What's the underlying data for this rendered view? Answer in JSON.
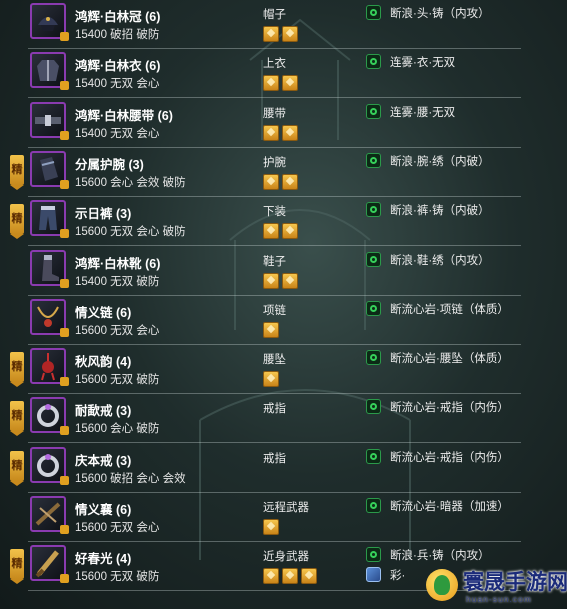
{
  "colors": {
    "name": "#ffffff",
    "divider": "#cdd6d6",
    "refine_badge": "#e8a830",
    "thumb_border": "#8a3bb0",
    "effect_green": "#36d05a"
  },
  "items": [
    {
      "name": "鸿辉·白林冠 (6)",
      "attrs": "15400 破招 破防",
      "slot": "帽子",
      "gems": 2,
      "refined": false,
      "icon": "hat-icon",
      "effects": [
        {
          "icon": "green",
          "text": "断浪·头·铸（内攻）"
        }
      ]
    },
    {
      "name": "鸿辉·白林衣 (6)",
      "attrs": "15400 无双 会心",
      "slot": "上衣",
      "gems": 2,
      "refined": false,
      "icon": "robe-icon",
      "effects": [
        {
          "icon": "green",
          "text": "连雾·衣·无双"
        }
      ]
    },
    {
      "name": "鸿辉·白林腰带 (6)",
      "attrs": "15400 无双 会心",
      "slot": "腰带",
      "gems": 2,
      "refined": false,
      "icon": "belt-icon",
      "effects": [
        {
          "icon": "green",
          "text": "连雾·腰·无双"
        }
      ]
    },
    {
      "name": "分属护腕 (3)",
      "attrs": "15600 会心 会效 破防",
      "slot": "护腕",
      "gems": 2,
      "refined": true,
      "icon": "bracer-icon",
      "effects": [
        {
          "icon": "green",
          "text": "断浪·腕·绣（内破）"
        }
      ]
    },
    {
      "name": "示日裤 (3)",
      "attrs": "15600 无双 会心 破防",
      "slot": "下装",
      "gems": 2,
      "refined": true,
      "icon": "pants-icon",
      "effects": [
        {
          "icon": "green",
          "text": "断浪·裤·铸（内破）"
        }
      ]
    },
    {
      "name": "鸿辉·白林靴 (6)",
      "attrs": "15400 无双 破防",
      "slot": "鞋子",
      "gems": 2,
      "refined": false,
      "icon": "boots-icon",
      "effects": [
        {
          "icon": "green",
          "text": "断浪·鞋·绣（内攻）"
        }
      ]
    },
    {
      "name": "情义链 (6)",
      "attrs": "15600 无双 会心",
      "slot": "项链",
      "gems": 1,
      "refined": false,
      "icon": "necklace-icon",
      "effects": [
        {
          "icon": "green",
          "text": "断流心岩·项链（体质）"
        }
      ]
    },
    {
      "name": "秋风韵 (4)",
      "attrs": "15600 无双 破防",
      "slot": "腰坠",
      "gems": 1,
      "refined": true,
      "icon": "pendant-icon",
      "effects": [
        {
          "icon": "green",
          "text": "断流心岩·腰坠（体质）"
        }
      ]
    },
    {
      "name": "耐歃戒 (3)",
      "attrs": "15600 会心 破防",
      "slot": "戒指",
      "gems": 0,
      "refined": true,
      "icon": "ring-icon",
      "effects": [
        {
          "icon": "green",
          "text": "断流心岩·戒指（内伤）"
        }
      ]
    },
    {
      "name": "庆本戒 (3)",
      "attrs": "15600 破招 会心 会效",
      "slot": "戒指",
      "gems": 0,
      "refined": true,
      "icon": "ring-icon",
      "effects": [
        {
          "icon": "green",
          "text": "断流心岩·戒指（内伤）"
        }
      ]
    },
    {
      "name": "情义襄 (6)",
      "attrs": "15600 无双 会心",
      "slot": "远程武器",
      "gems": 1,
      "refined": false,
      "icon": "ranged-weapon-icon",
      "effects": [
        {
          "icon": "green",
          "text": "断流心岩·暗器（加速）"
        }
      ]
    },
    {
      "name": "好春光 (4)",
      "attrs": "15600 无双 破防",
      "slot": "近身武器",
      "gems": 3,
      "refined": true,
      "icon": "melee-weapon-icon",
      "effects": [
        {
          "icon": "green",
          "text": "断浪·兵·铸（内攻）"
        },
        {
          "icon": "blue",
          "text": "彩·"
        }
      ]
    }
  ],
  "refine_label": "精",
  "watermark": {
    "title": "寰晟手游网",
    "url": "huan-sun.com"
  }
}
